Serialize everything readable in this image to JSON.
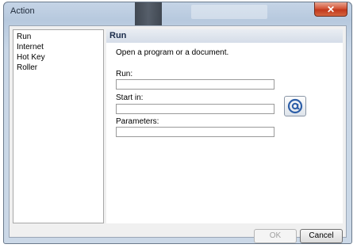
{
  "window": {
    "title": "Action",
    "close_glyph": "✕"
  },
  "actions": [
    {
      "label": "Run"
    },
    {
      "label": "Internet"
    },
    {
      "label": "Hot Key"
    },
    {
      "label": "Roller"
    }
  ],
  "panel": {
    "header": "Run",
    "description": "Open a program or a document.",
    "run_label": "Run:",
    "run_value": "",
    "start_in_label": "Start in:",
    "start_in_value": "",
    "parameters_label": "Parameters:",
    "parameters_value": "",
    "browse_icon": "at-sign-icon"
  },
  "buttons": {
    "ok": "OK",
    "cancel": "Cancel"
  }
}
